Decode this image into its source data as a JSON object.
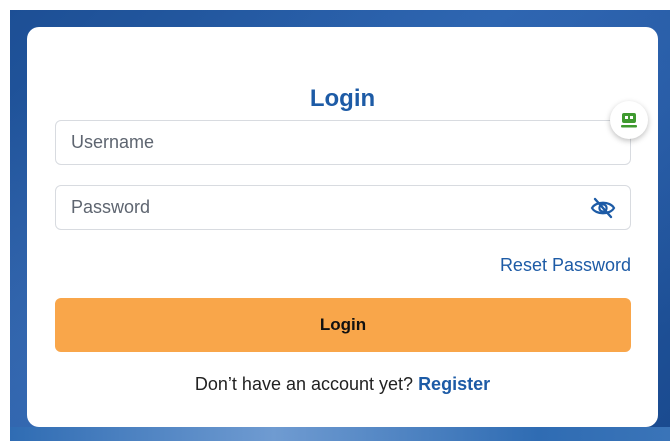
{
  "login_form": {
    "title": "Login",
    "username_placeholder": "Username",
    "password_placeholder": "Password",
    "reset_password_label": "Reset Password",
    "login_button_label": "Login",
    "register_prompt": "Don’t have an account yet? ",
    "register_link_label": "Register"
  },
  "icons": {
    "password_toggle": "eye-slash-icon",
    "extension_badge": "robot-icon"
  },
  "colors": {
    "accent": "#1d5ba6",
    "button": "#f9a64a",
    "background": "#1d4f95"
  }
}
